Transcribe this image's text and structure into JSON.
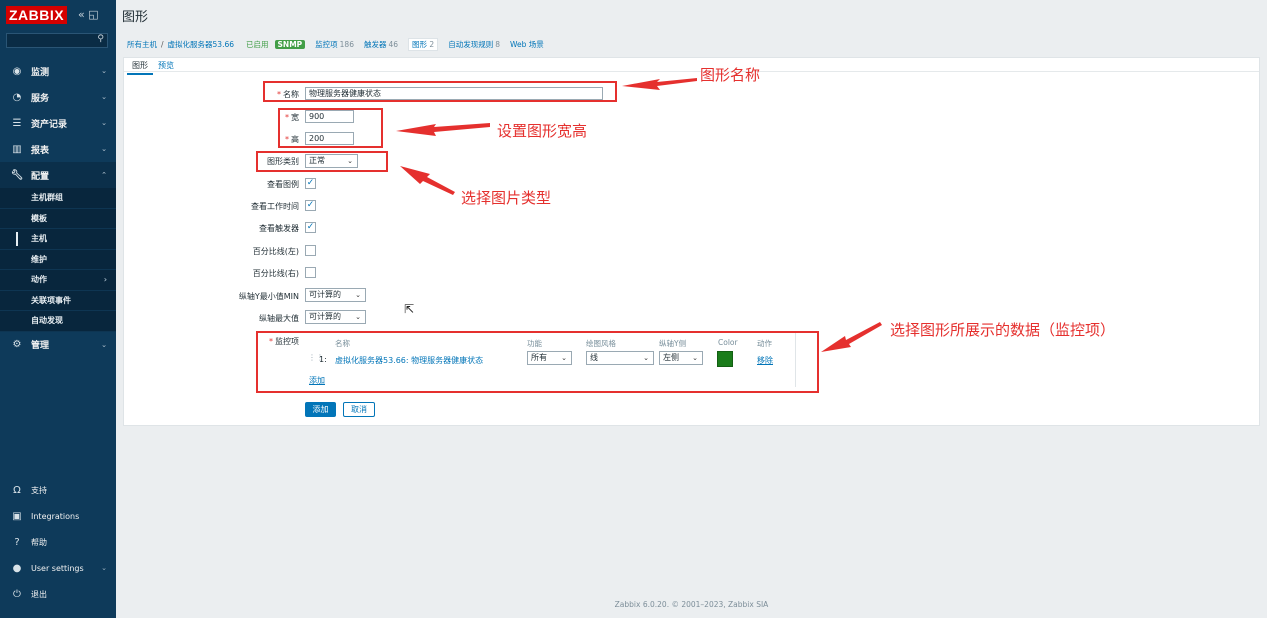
{
  "app": {
    "logo": "ZABBIX",
    "page_title": "图形"
  },
  "sidebar": {
    "main": [
      {
        "label": "监测",
        "icon": "eye-icon"
      },
      {
        "label": "服务",
        "icon": "clock-icon"
      },
      {
        "label": "资产记录",
        "icon": "list-icon"
      },
      {
        "label": "报表",
        "icon": "chart-icon"
      },
      {
        "label": "配置",
        "icon": "wrench-icon"
      }
    ],
    "config_sub": [
      "主机群组",
      "模板",
      "主机",
      "维护",
      "动作",
      "关联项事件",
      "自动发现"
    ],
    "admin": {
      "label": "管理",
      "icon": "gear-icon"
    },
    "bottom": [
      {
        "label": "支持",
        "icon": "headset-icon"
      },
      {
        "label": "Integrations",
        "icon": "integrations-icon"
      },
      {
        "label": "帮助",
        "icon": "help-icon"
      },
      {
        "label": "User settings",
        "icon": "user-icon"
      },
      {
        "label": "退出",
        "icon": "power-icon"
      }
    ]
  },
  "breadcrumb": {
    "all_hosts": "所有主机",
    "separator": "/",
    "host": "虚拟化服务器53.66",
    "status": "已启用",
    "snmp": "SNMP",
    "items_label": "监控项",
    "items_count": "186",
    "triggers_label": "触发器",
    "triggers_count": "46",
    "graphs_label": "图形",
    "graphs_count": "2",
    "discovery_label": "自动发现规则",
    "discovery_count": "8",
    "web_label": "Web 场景"
  },
  "tabs": [
    "图形",
    "预览"
  ],
  "form": {
    "name_label": "名称",
    "name_value": "物理服务器健康状态",
    "width_label": "宽",
    "width_value": "900",
    "height_label": "高",
    "height_value": "200",
    "type_label": "图形类别",
    "type_value": "正常",
    "show_legend_label": "查看图例",
    "show_worktime_label": "查看工作时间",
    "show_triggers_label": "查看触发器",
    "percent_left_label": "百分比线(左)",
    "percent_right_label": "百分比线(右)",
    "ymin_label": "纵轴Y最小值MIN",
    "ymin_value": "可计算的",
    "ymax_label": "纵轴最大值",
    "ymax_value": "可计算的",
    "items_label": "监控项",
    "items_headers": {
      "name": "名称",
      "function": "功能",
      "draw_style": "绘图风格",
      "y_axis": "纵轴Y侧",
      "color": "Color",
      "action": "动作"
    },
    "item_row": {
      "index": "1:",
      "name": "虚拟化服务器53.66: 物理服务器健康状态",
      "function": "所有",
      "draw_style": "线",
      "y_axis": "左侧",
      "color": "#1a7c1a",
      "remove": "移除"
    },
    "add_item_link": "添加",
    "add_button": "添加",
    "cancel_button": "取消"
  },
  "footer": "Zabbix 6.0.20. © 2001–2023, Zabbix SIA",
  "annotations": {
    "graph_name": "图形名称",
    "size": "设置图形宽高",
    "type": "选择图片类型",
    "data": "选择图形所展示的数据（监控项）"
  }
}
